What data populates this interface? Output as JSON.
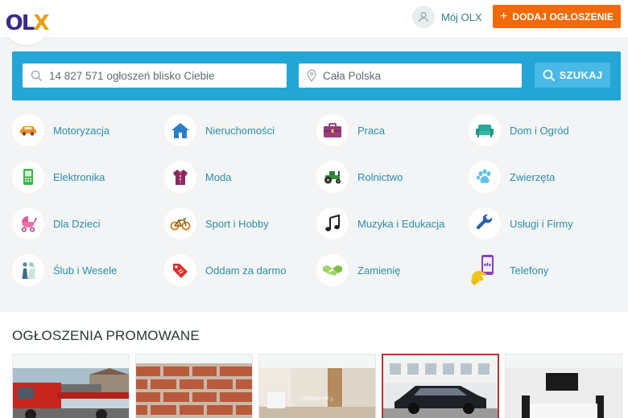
{
  "header": {
    "logo": {
      "o": "O",
      "l": "L",
      "x": "X"
    },
    "my_olx_label": "Mój OLX",
    "add_button_label": "DODAJ OGŁOSZENIE",
    "add_button_color": "#f06a0a"
  },
  "search": {
    "query_placeholder": "14 827 571 ogłoszeń blisko Ciebie",
    "location_placeholder": "Cała Polska",
    "button_label": "SZUKAJ",
    "band_color": "#23a6d5"
  },
  "categories": [
    {
      "label": "Motoryzacja",
      "icon": "car-icon"
    },
    {
      "label": "Nieruchomości",
      "icon": "house-icon"
    },
    {
      "label": "Praca",
      "icon": "briefcase-icon"
    },
    {
      "label": "Dom i Ogród",
      "icon": "sofa-icon"
    },
    {
      "label": "Elektronika",
      "icon": "phone-icon"
    },
    {
      "label": "Moda",
      "icon": "jacket-icon"
    },
    {
      "label": "Rolnictwo",
      "icon": "tractor-icon"
    },
    {
      "label": "Zwierzęta",
      "icon": "paw-icon"
    },
    {
      "label": "Dla Dzieci",
      "icon": "stroller-icon"
    },
    {
      "label": "Sport i Hobby",
      "icon": "bicycle-icon"
    },
    {
      "label": "Muzyka i Edukacja",
      "icon": "music-note-icon"
    },
    {
      "label": "Usługi i Firmy",
      "icon": "wrench-icon"
    },
    {
      "label": "Ślub i Wesele",
      "icon": "wedding-couple-icon"
    },
    {
      "label": "Oddam za darmo",
      "icon": "price-tag-icon"
    },
    {
      "label": "Zamienię",
      "icon": "handshake-icon"
    },
    {
      "label": "Telefony",
      "icon": "smartphone-hand-icon"
    }
  ],
  "promoted": {
    "title": "OGŁOSZENIA PROMOWANE",
    "cards": [
      {
        "image": "tow-truck-photo"
      },
      {
        "image": "brick-wall-photo"
      },
      {
        "image": "room-interior-photo",
        "watermark": "CZERSKI SP. J."
      },
      {
        "image": "black-car-photo",
        "highlighted": true
      },
      {
        "image": "living-room-tv-photo"
      }
    ]
  }
}
